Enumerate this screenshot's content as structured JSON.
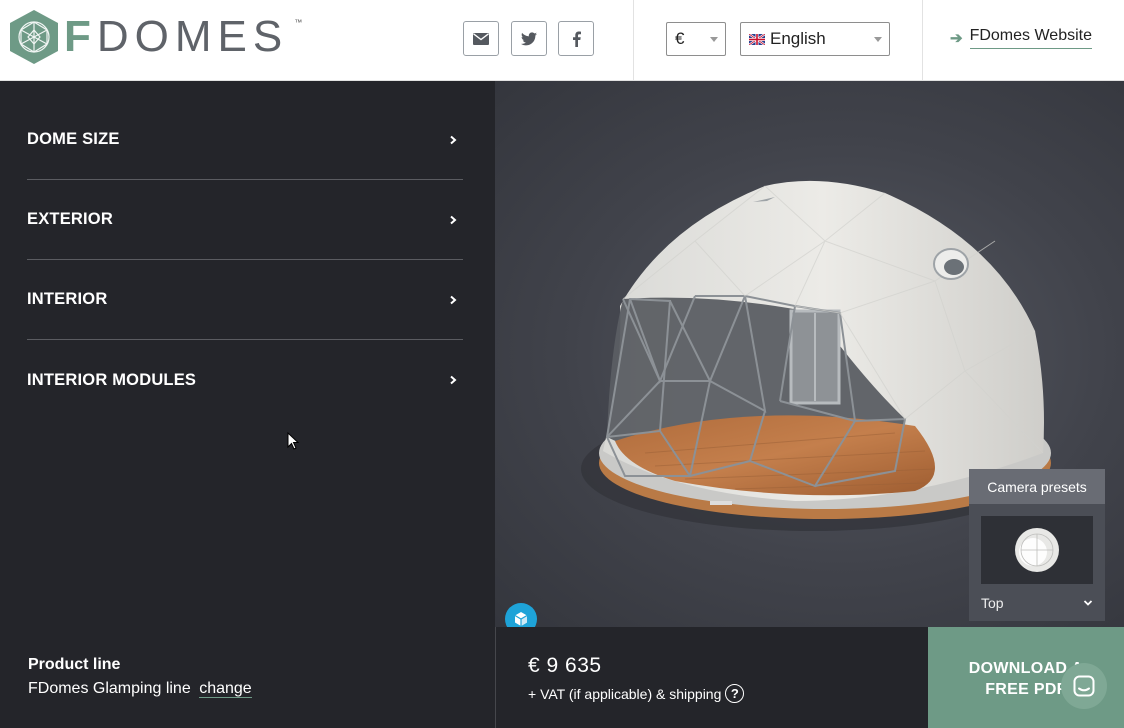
{
  "brand": {
    "logo_name": "FDOMES",
    "trademark": "™",
    "accent": "#6e9a86",
    "dark_panel": "#24252a"
  },
  "header": {
    "social": [
      {
        "name": "email",
        "icon": "envelope-icon"
      },
      {
        "name": "twitter",
        "icon": "twitter-icon"
      },
      {
        "name": "facebook",
        "icon": "facebook-icon"
      }
    ],
    "currency": {
      "value": "€"
    },
    "language": {
      "value": "English",
      "flag": "uk-flag-icon"
    },
    "website_link": "FDomes Website"
  },
  "sidebar": {
    "items": [
      {
        "label": "DOME SIZE"
      },
      {
        "label": "EXTERIOR"
      },
      {
        "label": "INTERIOR"
      },
      {
        "label": "INTERIOR MODULES"
      }
    ]
  },
  "viewer": {
    "camera_presets": {
      "title": "Camera presets",
      "selected": "Top"
    }
  },
  "footer": {
    "product_line_title": "Product line",
    "product_line_value": "FDomes Glamping line",
    "change_link": "change",
    "price": "€ 9 635",
    "price_note": "+ VAT (if applicable) & shipping",
    "help_symbol": "?",
    "download_line1": "DOWNLOAD A",
    "download_line2": "FREE PDF"
  }
}
